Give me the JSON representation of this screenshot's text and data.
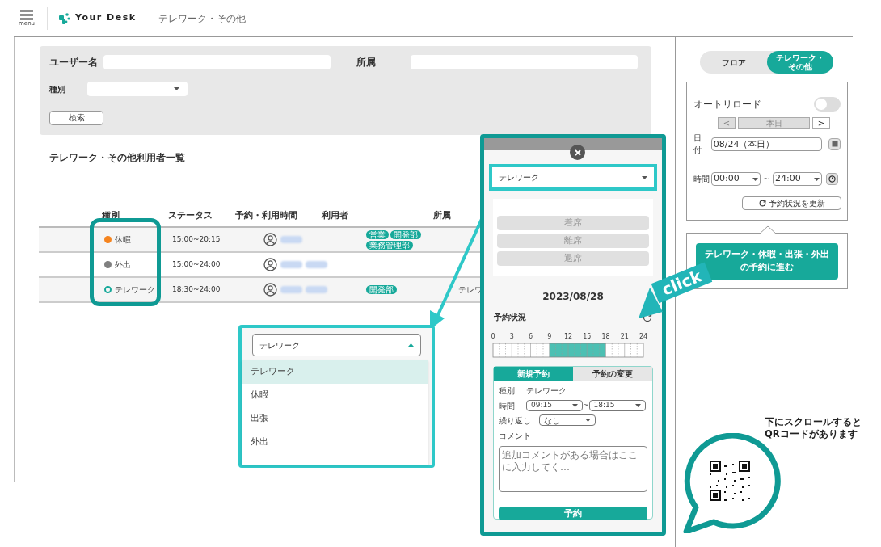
{
  "header": {
    "menu_label": "menu",
    "brand": "Your Desk",
    "title": "テレワーク・その他"
  },
  "search": {
    "fields": [
      {
        "label": "ユーザー名",
        "kind": "text"
      },
      {
        "label": "所属",
        "kind": "text"
      },
      {
        "label": "種別",
        "kind": "select"
      }
    ],
    "button": "検索"
  },
  "list": {
    "title": "テレワーク・その他利用者一覧",
    "columns": [
      "種別",
      "ステータス",
      "予約・利用時間",
      "利用者",
      "所属"
    ],
    "rows": [
      {
        "type": "休暇",
        "kind": "dot",
        "color": "#f5841f",
        "time": "15:00~20:15",
        "users": [
          {
            "kind": "blurred"
          }
        ],
        "departments": [
          "営業",
          "開発部",
          "業務管理部"
        ]
      },
      {
        "type": "外出",
        "kind": "dot",
        "color": "#808080",
        "time": "15:00~24:00",
        "users": [
          {
            "kind": "blurred"
          },
          {
            "kind": "blurred"
          }
        ],
        "departments": []
      },
      {
        "type": "テレワーク",
        "kind": "ring",
        "color": "#17a99a",
        "time": "18:30~24:00",
        "users": [
          {
            "kind": "blurred"
          },
          {
            "kind": "blurred"
          }
        ],
        "departments": [
          "開発部"
        ],
        "column_5": "テレワ"
      }
    ]
  },
  "popup": {
    "type_select": "テレワーク",
    "actions": [
      {
        "label": "着席",
        "disabled": true
      },
      {
        "label": "離席",
        "disabled": true
      },
      {
        "label": "退席",
        "disabled": true
      }
    ],
    "date": "2023/08/28",
    "status_label": "予約状況",
    "chart_data": {
      "type": "bar",
      "orientation": "horizontal",
      "stacked": true,
      "xlim": [
        0,
        24
      ],
      "xticks": [
        0,
        3,
        6,
        9,
        12,
        15,
        18,
        21,
        24
      ],
      "grid": true,
      "series": [
        {
          "color": "#ffffff",
          "values": [
            9
          ]
        },
        {
          "color": "#4cc0b3",
          "values": [
            9
          ]
        },
        {
          "color": "#ffffff",
          "values": [
            6
          ]
        }
      ]
    },
    "tabs": [
      {
        "label": "新規予約",
        "selected": true
      },
      {
        "label": "予約の変更",
        "selected": false
      }
    ],
    "form": {
      "type_label": "種別",
      "type_value": "テレワーク",
      "time_label": "時間",
      "time_from": "09:15",
      "tilde": "~",
      "time_to": "18:15",
      "repeat_label": "繰り返し",
      "repeat_value": "なし",
      "comment_label": "コメント",
      "comment_placeholder": "追加コメントがある場合はここに入力してく…",
      "submit": "予約"
    }
  },
  "dropdown": {
    "value": "テレワーク",
    "expanded": true,
    "options": [
      {
        "label": "テレワーク",
        "selected": true
      },
      {
        "label": "休暇",
        "selected": false
      },
      {
        "label": "出張",
        "selected": false
      },
      {
        "label": "外出",
        "selected": false
      }
    ]
  },
  "side": {
    "views": [
      {
        "label": "フロア",
        "selected": false
      },
      {
        "label": "テレワーク・その他",
        "selected": true
      }
    ],
    "auto_reload": {
      "label": "オートリロード",
      "on": false
    },
    "prev": "<",
    "today": "本日",
    "next": ">",
    "date_label": "日付",
    "date": "08/24（本日）",
    "time_label": "時間",
    "time_from": "00:00",
    "tilde": "～",
    "time_to": "24:00",
    "refresh": "予約状況を更新",
    "proceed": "テレワーク・休暇・出張・外出の予約に進む"
  },
  "annotations": {
    "click": "click",
    "note_lines": [
      "下にスクロールすると",
      "QRコードがあります"
    ]
  }
}
